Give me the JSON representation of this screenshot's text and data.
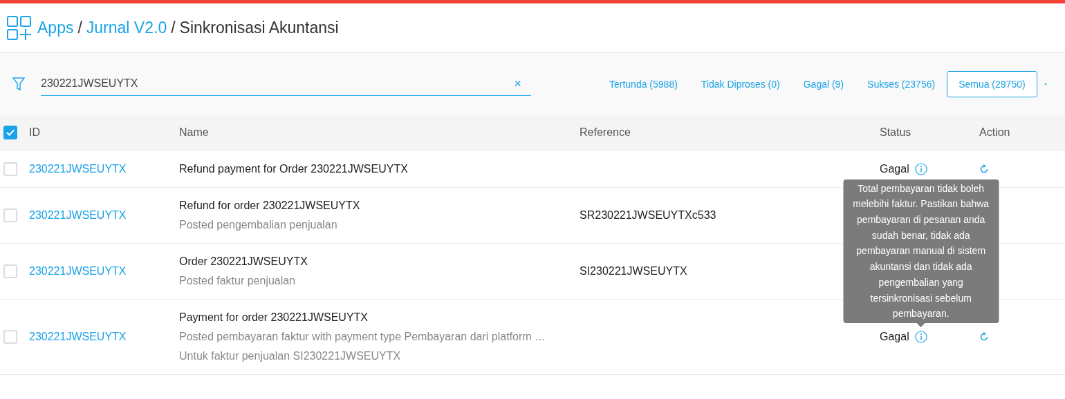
{
  "breadcrumb": [
    {
      "label": "Apps",
      "link": true
    },
    {
      "label": "Jurnal V2.0",
      "link": true,
      "separator": "/"
    },
    {
      "label": "Sinkronisasi Akuntansi",
      "link": false,
      "separator": "/"
    }
  ],
  "search": {
    "value": "230221JWSEUYTX",
    "clear_icon": "×"
  },
  "filters": [
    {
      "label": "Tertunda (5988)",
      "selected": false
    },
    {
      "label": "Tidak Diproses (0)",
      "selected": false
    },
    {
      "label": "Gagal (9)",
      "selected": false
    },
    {
      "label": "Sukses (23756)",
      "selected": false
    },
    {
      "label": "Semua (29750)",
      "selected": true
    }
  ],
  "table": {
    "select_all_checked": true,
    "columns": [
      "ID",
      "Name",
      "Reference",
      "Status",
      "Action"
    ],
    "rows": [
      {
        "checked": false,
        "id": "230221JWSEUYTX",
        "name": "Refund payment for Order 230221JWSEUYTX",
        "details": [],
        "reference": "",
        "status": {
          "label": "Gagal",
          "info": true
        }
      },
      {
        "checked": false,
        "id": "230221JWSEUYTX",
        "name": "Refund for order 230221JWSEUYTX",
        "details": [
          "Posted pengembalian penjualan"
        ],
        "reference": "SR230221JWSEUYTXc533"
      },
      {
        "checked": false,
        "id": "230221JWSEUYTX",
        "name": "Order 230221JWSEUYTX",
        "details": [
          "Posted faktur penjualan"
        ],
        "reference": "SI230221JWSEUYTX"
      },
      {
        "checked": false,
        "id": "230221JWSEUYTX",
        "name": "Payment for order 230221JWSEUYTX",
        "details": [
          "Posted pembayaran faktur with payment type Pembayaran dari platform …",
          "Untuk faktur penjualan SI230221JWSEUYTX"
        ],
        "reference": "",
        "status": {
          "label": "Gagal",
          "info": true,
          "tooltip": "Total pembayaran tidak boleh melebihi faktur. Pastikan bahwa pembayaran di pesanan anda sudah benar, tidak ada pembayaran manual di sistem akuntansi dan tidak ada pengembalian yang tersinkronisasi sebelum pembayaran."
        }
      }
    ]
  }
}
